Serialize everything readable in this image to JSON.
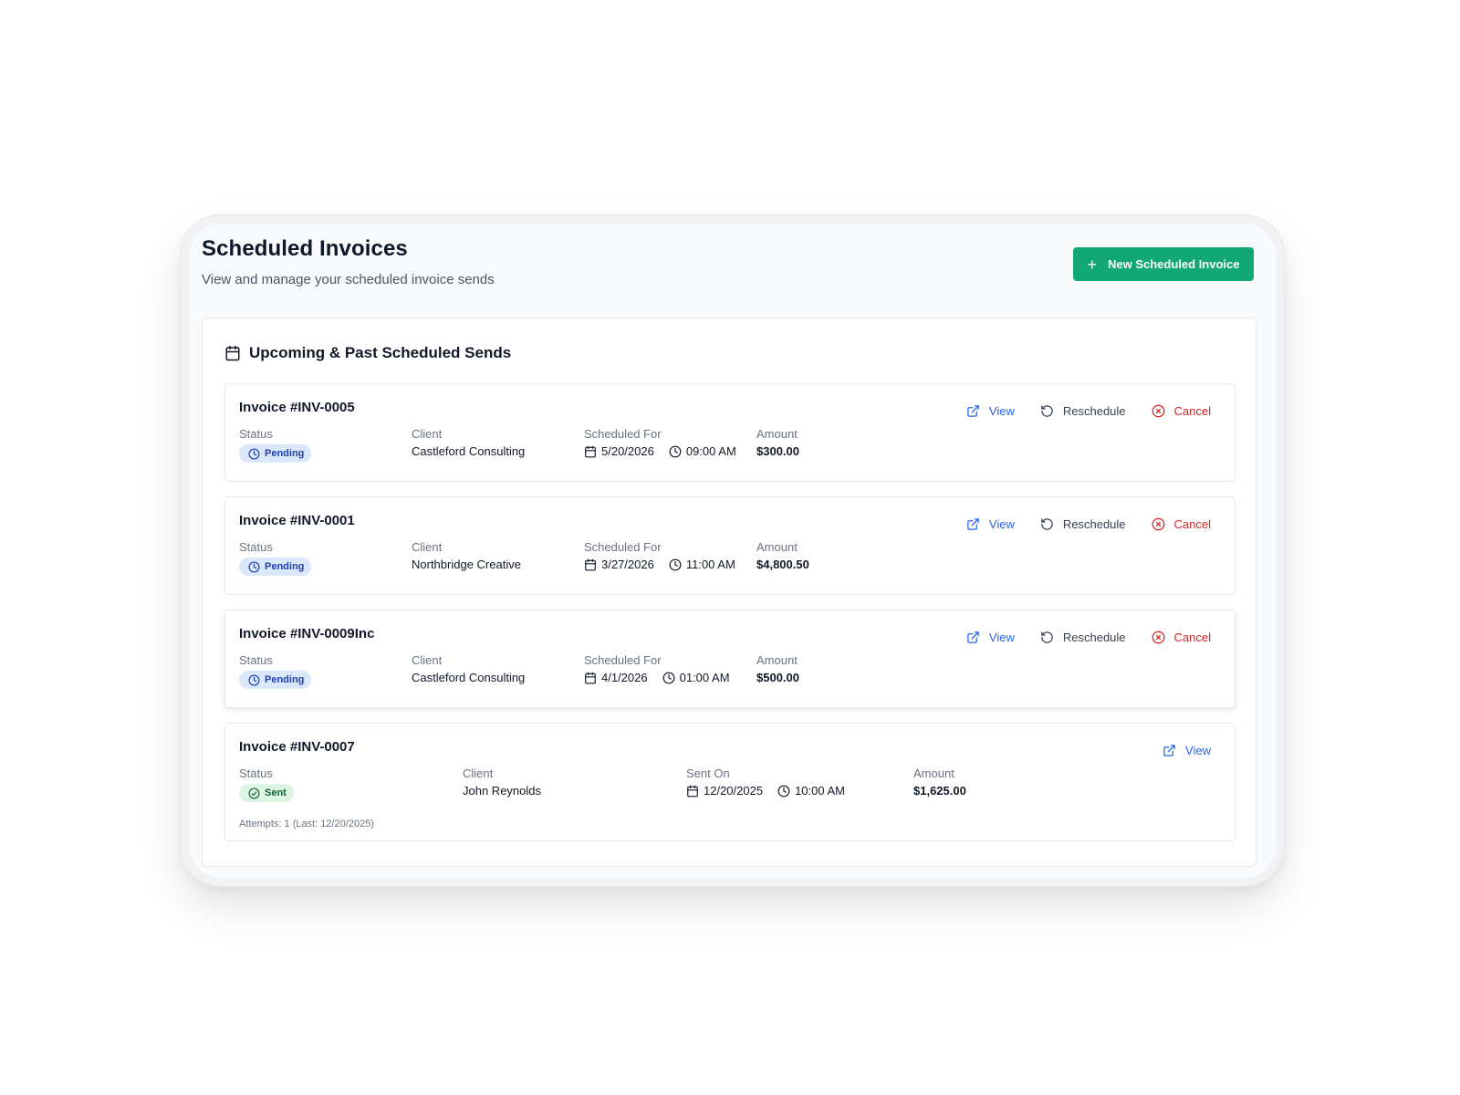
{
  "header": {
    "title": "Scheduled Invoices",
    "subtitle": "View and manage your scheduled invoice sends",
    "new_button_label": "New Scheduled Invoice"
  },
  "panel": {
    "title": "Upcoming & Past Scheduled Sends"
  },
  "labels": {
    "status": "Status",
    "client": "Client",
    "scheduled_for": "Scheduled For",
    "sent_on": "Sent On",
    "amount": "Amount",
    "view": "View",
    "reschedule": "Reschedule",
    "cancel": "Cancel"
  },
  "invoices": [
    {
      "title": "Invoice #INV-0005",
      "status": "Pending",
      "client": "Castleford Consulting",
      "date": "5/20/2026",
      "time": "09:00 AM",
      "amount": "$300.00"
    },
    {
      "title": "Invoice #INV-0001",
      "status": "Pending",
      "client": "Northbridge Creative",
      "date": "3/27/2026",
      "time": "11:00 AM",
      "amount": "$4,800.50"
    },
    {
      "title": "Invoice #INV-0009Inc",
      "status": "Pending",
      "client": "Castleford Consulting",
      "date": "4/1/2026",
      "time": "01:00 AM",
      "amount": "$500.00"
    },
    {
      "title": "Invoice #INV-0007",
      "status": "Sent",
      "client": "John Reynolds",
      "date": "12/20/2025",
      "time": "10:00 AM",
      "amount": "$1,625.00",
      "attempts": "Attempts: 1 (Last: 12/20/2025)"
    }
  ],
  "colors": {
    "primary_button": "#12a876",
    "pending_badge_bg": "#dbe7fb",
    "pending_badge_text": "#1e40af",
    "sent_badge_bg": "#dcf5e4",
    "sent_badge_text": "#166534",
    "view_link": "#2563eb",
    "cancel_link": "#dc2626"
  }
}
